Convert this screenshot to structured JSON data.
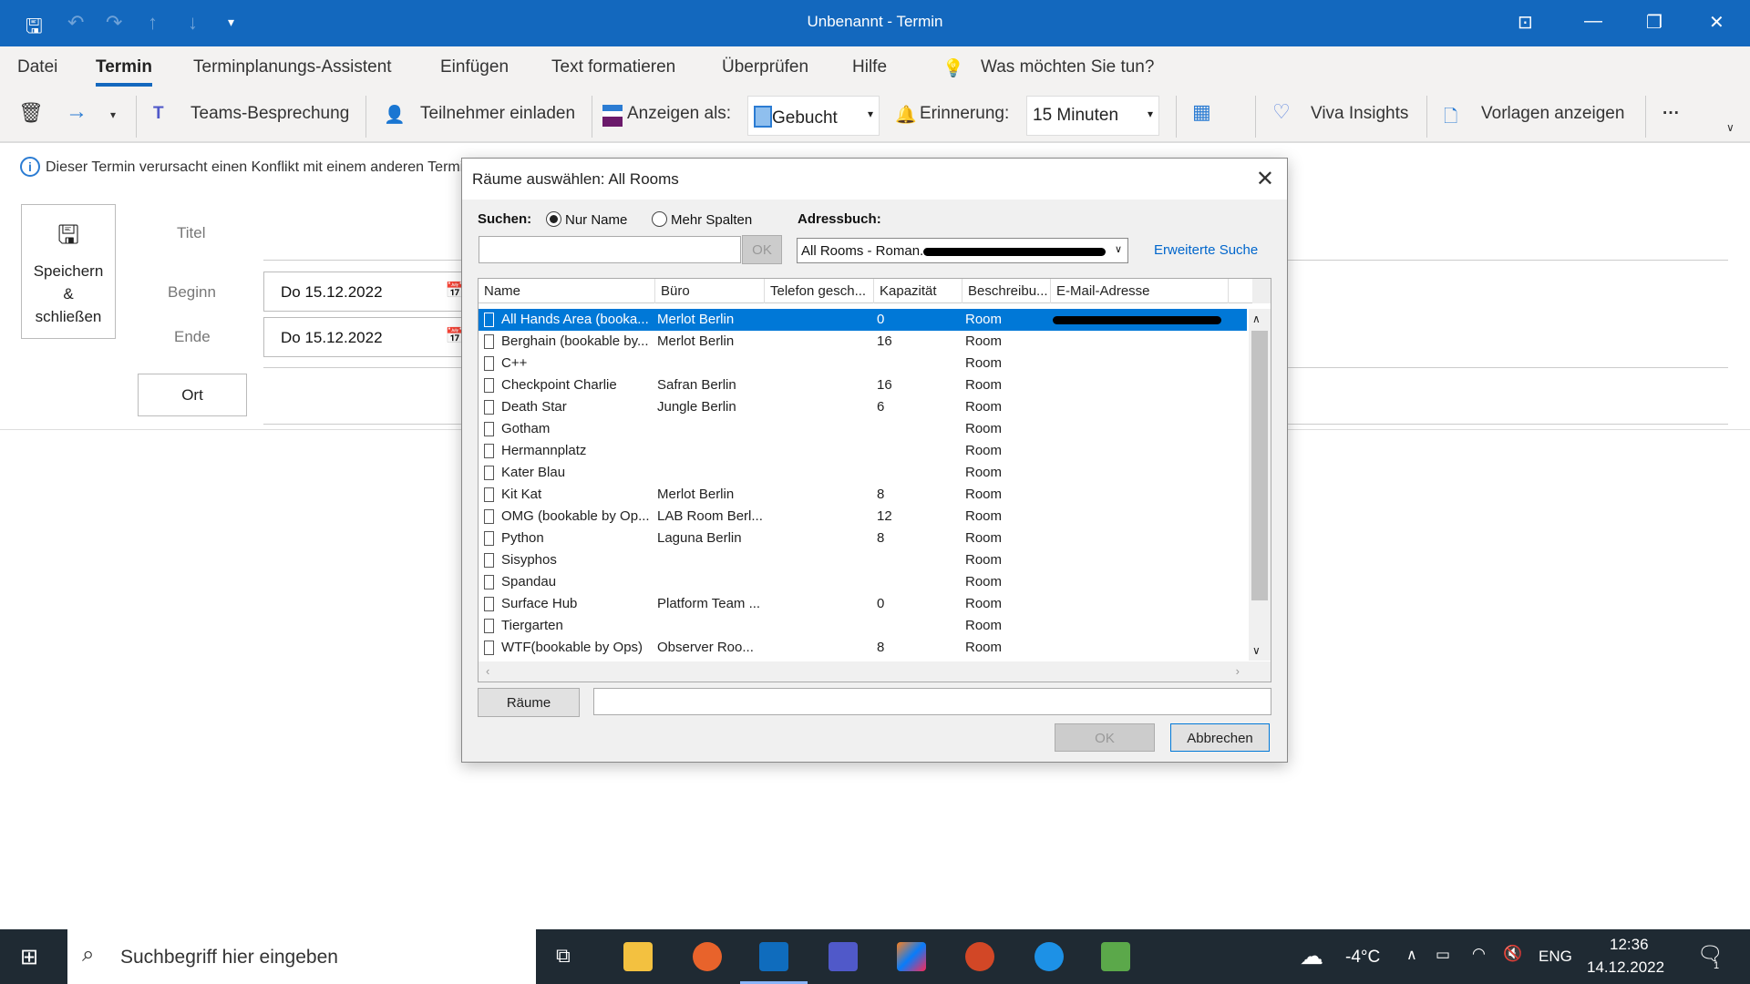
{
  "window": {
    "title": "Unbenannt  -  Termin"
  },
  "menu": {
    "tabs": [
      "Datei",
      "Termin",
      "Terminplanungs-Assistent",
      "Einfügen",
      "Text formatieren",
      "Überprüfen",
      "Hilfe"
    ],
    "tell_me": "Was möchten Sie tun?"
  },
  "ribbon": {
    "teams": "Teams-Besprechung",
    "invite": "Teilnehmer einladen",
    "show_as_label": "Anzeigen als:",
    "show_as_value": "Gebucht",
    "reminder_label": "Erinnerung:",
    "reminder_value": "15 Minuten",
    "viva": "Viva Insights",
    "templates": "Vorlagen anzeigen",
    "more": "···"
  },
  "form": {
    "info": "Dieser Termin verursacht einen Konflikt mit einem anderen Termi",
    "save_close": [
      "Speichern",
      "&",
      "schließen"
    ],
    "title_label": "Titel",
    "start_label": "Beginn",
    "start_value": "Do 15.12.2022",
    "end_label": "Ende",
    "end_value": "Do 15.12.2022",
    "location_button": "Ort"
  },
  "dialog": {
    "title": "Räume auswählen: All Rooms",
    "search_label": "Suchen:",
    "radio_name": "Nur Name",
    "radio_more": "Mehr Spalten",
    "search_value": "",
    "ok_search": "OK",
    "addressbook_label": "Adressbuch:",
    "addressbook_value": "All Rooms - Roman.",
    "advanced": "Erweiterte Suche",
    "columns": [
      "Name",
      "Büro",
      "Telefon gesch...",
      "Kapazität",
      "Beschreibu...",
      "E-Mail-Adresse"
    ],
    "rows": [
      [
        "All Hands Area (booka...",
        "Merlot Berlin",
        "0",
        "Room"
      ],
      [
        "Berghain (bookable by...",
        "Merlot Berlin",
        "16",
        "Room"
      ],
      [
        "C++",
        "",
        "",
        "Room"
      ],
      [
        "Checkpoint Charlie",
        "Safran Berlin",
        "16",
        "Room"
      ],
      [
        "Death Star",
        "Jungle Berlin",
        "6",
        "Room"
      ],
      [
        "Gotham",
        "",
        "",
        "Room"
      ],
      [
        "Hermannplatz",
        "",
        "",
        "Room"
      ],
      [
        "Kater Blau",
        "",
        "",
        "Room"
      ],
      [
        "Kit Kat",
        "Merlot Berlin",
        "8",
        "Room"
      ],
      [
        "OMG (bookable by Op...",
        "LAB Room Berl...",
        "12",
        "Room"
      ],
      [
        "Python",
        "Laguna Berlin",
        "8",
        "Room"
      ],
      [
        "Sisyphos",
        "",
        "",
        "Room"
      ],
      [
        "Spandau",
        "",
        "",
        "Room"
      ],
      [
        "Surface Hub",
        "Platform Team ...",
        "0",
        "Room"
      ],
      [
        "Tiergarten",
        "",
        "",
        "Room"
      ],
      [
        "WTF(bookable by Ops)",
        "Observer Roo...",
        "8",
        "Room"
      ]
    ],
    "rooms_button": "Räume",
    "rooms_value": "",
    "ok": "OK",
    "cancel": "Abbrechen"
  },
  "taskbar": {
    "search_placeholder": "Suchbegriff hier eingeben",
    "temperature": "-4°C",
    "lang": "ENG",
    "time": "12:36",
    "date": "14.12.2022",
    "notifications": "1"
  }
}
